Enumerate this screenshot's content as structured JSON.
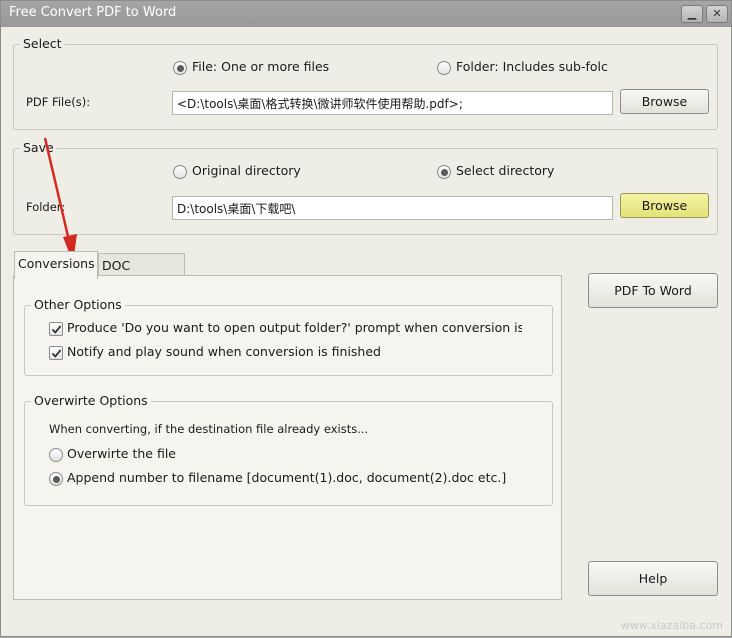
{
  "window": {
    "title": "Free Convert PDF to Word"
  },
  "titlebar": {
    "minimize_glyph": "▁",
    "close_glyph": "✕"
  },
  "select_group": {
    "title": "Select",
    "radio_file": "File:  One or more files",
    "radio_folder": "Folder: Includes sub-folc",
    "pdf_label": "PDF File(s):",
    "pdf_value": "<D:\\tools\\桌面\\格式转换\\微讲师软件使用帮助.pdf>;",
    "browse": "Browse",
    "selected": "file"
  },
  "save_group": {
    "title": "Save",
    "radio_original": "Original directory",
    "radio_select": "Select directory",
    "folder_label": "Folder:",
    "folder_value": "D:\\tools\\桌面\\下载吧\\",
    "browse": "Browse",
    "selected": "select"
  },
  "tabs": [
    {
      "label": "Conversions",
      "active": true
    },
    {
      "label": "DOC Options",
      "active": false
    }
  ],
  "other_options": {
    "title": "Other Options",
    "items": [
      {
        "label": "Produce 'Do you want to open output folder?' prompt when conversion is finis",
        "checked": true
      },
      {
        "label": "Notify and play sound when conversion is finished",
        "checked": true
      }
    ]
  },
  "overwrite_options": {
    "title": "Overwirte Options",
    "description": "When converting, if the destination file already exists...",
    "options": [
      {
        "label": "Overwirte the file",
        "selected": false
      },
      {
        "label": "Append number to filename  [document(1).doc, document(2).doc etc.]",
        "selected": true
      }
    ]
  },
  "actions": {
    "convert": "PDF To Word",
    "help": "Help"
  },
  "watermark": "www.xiazaiba.com",
  "colors": {
    "annotation_arrow": "#d42a22",
    "browse_highlight": "#e9e87f"
  }
}
